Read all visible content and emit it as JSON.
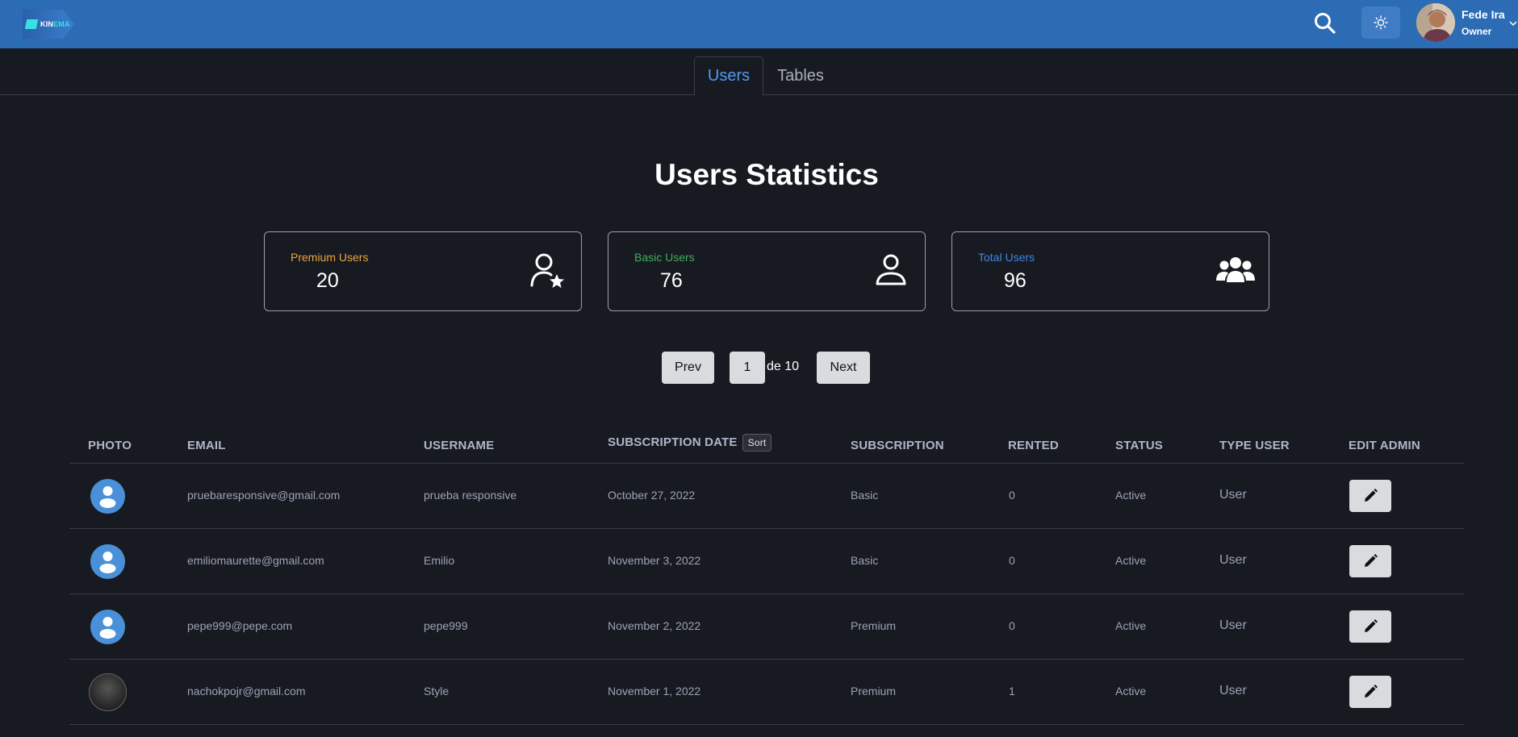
{
  "nav": {
    "logo_prefix": "KIN",
    "logo_suffix": "EMA",
    "user_name": "Fede Ira",
    "user_role": "Owner"
  },
  "tabs": [
    {
      "label": "Users",
      "active": true
    },
    {
      "label": "Tables",
      "active": false
    }
  ],
  "title": "Users Statistics",
  "stats": {
    "premium": {
      "label": "Premium Users",
      "value": "20",
      "color": "#f0a63a"
    },
    "basic": {
      "label": "Basic Users",
      "value": "76",
      "color": "#3fae5b"
    },
    "total": {
      "label": "Total Users",
      "value": "96",
      "color": "#3d87e0"
    }
  },
  "pagination": {
    "prev": "Prev",
    "page": "1",
    "of": "de 10",
    "next": "Next"
  },
  "table": {
    "headers": {
      "photo": "PHOTO",
      "email": "EMAIL",
      "username": "USERNAME",
      "subscription_date": "SUBSCRIPTION DATE",
      "sort": "Sort",
      "subscription": "SUBSCRIPTION",
      "rented": "RENTED",
      "status": "STATUS",
      "type_user": "TYPE USER",
      "edit_admin": "EDIT ADMIN"
    },
    "rows": [
      {
        "photo": "default-avatar",
        "email": "pruebaresponsive@gmail.com",
        "username": "prueba responsive",
        "date": "October 27, 2022",
        "subscription": "Basic",
        "rented": "0",
        "status": "Active",
        "type": "User"
      },
      {
        "photo": "default-avatar",
        "email": "emiliomaurette@gmail.com",
        "username": "Emilio",
        "date": "November 3, 2022",
        "subscription": "Basic",
        "rented": "0",
        "status": "Active",
        "type": "User"
      },
      {
        "photo": "default-avatar",
        "email": "pepe999@pepe.com",
        "username": "pepe999",
        "date": "November 2, 2022",
        "subscription": "Premium",
        "rented": "0",
        "status": "Active",
        "type": "User"
      },
      {
        "photo": "custom-photo",
        "email": "nachokpojr@gmail.com",
        "username": "Style",
        "date": "November 1, 2022",
        "subscription": "Premium",
        "rented": "1",
        "status": "Active",
        "type": "User"
      }
    ]
  }
}
